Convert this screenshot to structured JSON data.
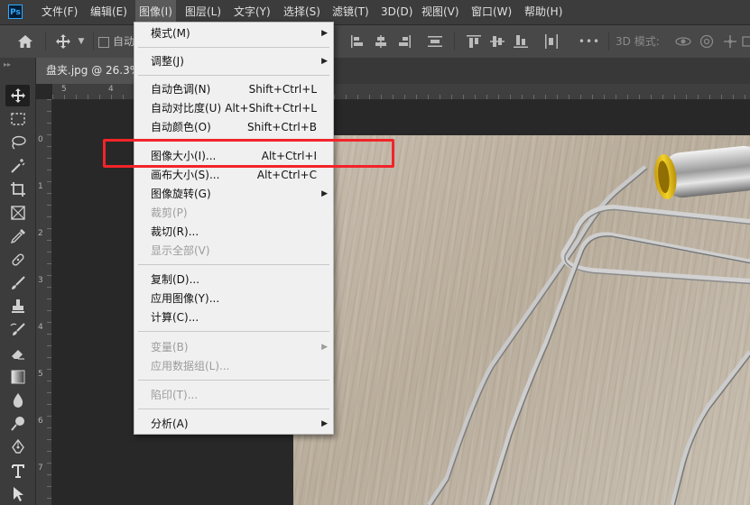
{
  "app": {
    "logo": "Ps"
  },
  "menubar": {
    "items": [
      "文件(F)",
      "编辑(E)",
      "图像(I)",
      "图层(L)",
      "文字(Y)",
      "选择(S)",
      "滤镜(T)",
      "3D(D)",
      "视图(V)",
      "窗口(W)",
      "帮助(H)"
    ],
    "active": "图像(I)"
  },
  "options_bar": {
    "auto_label": "自动",
    "mode_3d_label": "3D 模式:",
    "more": "•••"
  },
  "document": {
    "tab_label": "盘夹.jpg @ 26.3%"
  },
  "rulers": {
    "top_ticks": [
      "5",
      "4"
    ],
    "left_ticks": [
      "0",
      "1",
      "2",
      "3",
      "4",
      "5",
      "6",
      "7"
    ]
  },
  "image_menu": {
    "items": [
      {
        "label": "模式(M)",
        "shortcut": "",
        "submenu": true,
        "disabled": false
      },
      {
        "label": "调整(J)",
        "shortcut": "",
        "submenu": true,
        "disabled": false
      },
      {
        "label": "自动色调(N)",
        "shortcut": "Shift+Ctrl+L",
        "submenu": false,
        "disabled": false
      },
      {
        "label": "自动对比度(U)",
        "shortcut": "Alt+Shift+Ctrl+L",
        "submenu": false,
        "disabled": false
      },
      {
        "label": "自动颜色(O)",
        "shortcut": "Shift+Ctrl+B",
        "submenu": false,
        "disabled": false
      },
      {
        "label": "图像大小(I)...",
        "shortcut": "Alt+Ctrl+I",
        "submenu": false,
        "disabled": false
      },
      {
        "label": "画布大小(S)...",
        "shortcut": "Alt+Ctrl+C",
        "submenu": false,
        "disabled": false
      },
      {
        "label": "图像旋转(G)",
        "shortcut": "",
        "submenu": true,
        "disabled": false
      },
      {
        "label": "裁剪(P)",
        "shortcut": "",
        "submenu": false,
        "disabled": true
      },
      {
        "label": "裁切(R)...",
        "shortcut": "",
        "submenu": false,
        "disabled": false
      },
      {
        "label": "显示全部(V)",
        "shortcut": "",
        "submenu": false,
        "disabled": true
      },
      {
        "label": "复制(D)...",
        "shortcut": "",
        "submenu": false,
        "disabled": false
      },
      {
        "label": "应用图像(Y)...",
        "shortcut": "",
        "submenu": false,
        "disabled": false
      },
      {
        "label": "计算(C)...",
        "shortcut": "",
        "submenu": false,
        "disabled": false
      },
      {
        "label": "变量(B)",
        "shortcut": "",
        "submenu": true,
        "disabled": true
      },
      {
        "label": "应用数据组(L)...",
        "shortcut": "",
        "submenu": false,
        "disabled": true
      },
      {
        "label": "陷印(T)...",
        "shortcut": "",
        "submenu": false,
        "disabled": true
      },
      {
        "label": "分析(A)",
        "shortcut": "",
        "submenu": true,
        "disabled": false
      }
    ],
    "highlighted": "图像大小(I)..."
  },
  "colors": {
    "menubar_bg": "#3c3c3c",
    "menu_bg": "#f0f0f0",
    "highlight_box": "#f2242a",
    "ps_blue": "#31a8ff",
    "clip_yellow": "#e8c21a"
  }
}
